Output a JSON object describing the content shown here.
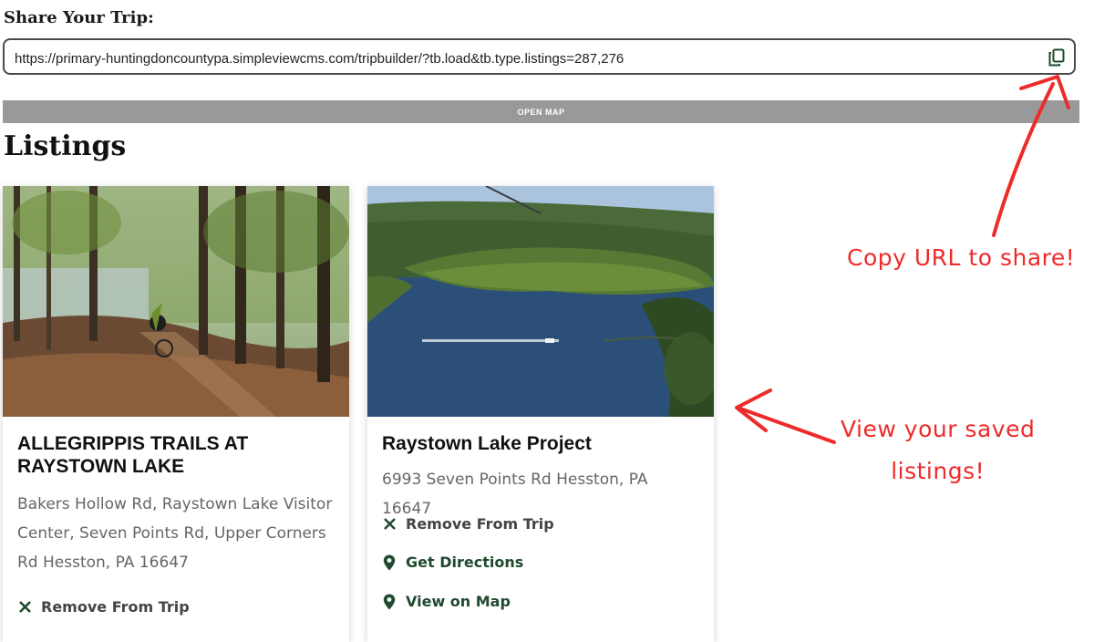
{
  "share": {
    "title": "Share Your Trip:",
    "url": "https://primary-huntingdoncountypa.simpleviewcms.com/tripbuilder/?tb.load&tb.type.listings=287,276",
    "copy_icon": "copy-icon"
  },
  "open_map_label": "OPEN MAP",
  "listings_title": "Listings",
  "listings": [
    {
      "title": "ALLEGRIPPIS TRAILS AT RAYSTOWN LAKE",
      "address": "Bakers Hollow Rd, Raystown Lake Visitor Center, Seven Points Rd, Upper Corners Rd Hesston, PA 16647",
      "remove_label": "Remove From Trip"
    },
    {
      "title": "Raystown Lake Project",
      "address": "6993 Seven Points Rd Hesston, PA 16647",
      "remove_label": "Remove From Trip",
      "directions_label": "Get Directions",
      "view_map_label": "View on Map"
    }
  ],
  "annotations": {
    "copy": "Copy URL to share!",
    "view_line1": "View your saved",
    "view_line2": "listings!"
  },
  "colors": {
    "brand_green": "#1f4a2e",
    "annotation_red": "#ee2b2b",
    "open_map_bg": "#999999"
  }
}
